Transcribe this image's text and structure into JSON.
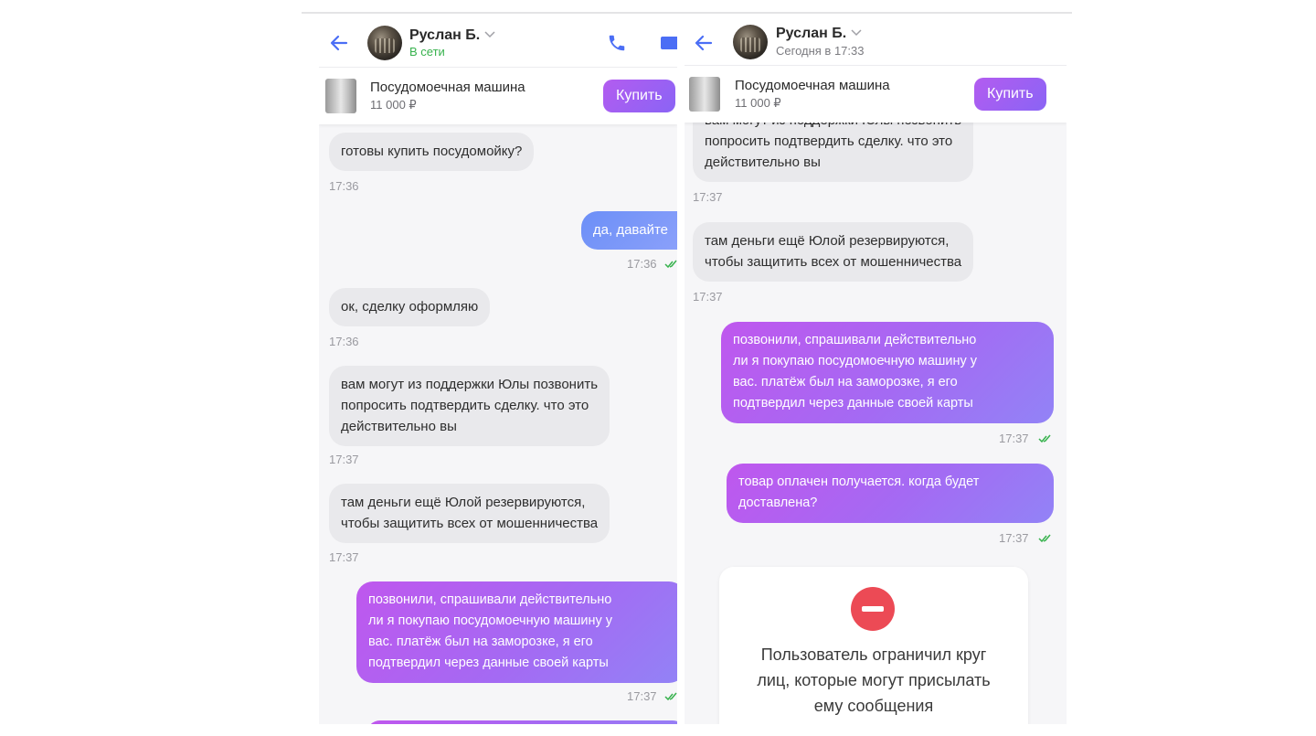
{
  "left": {
    "header": {
      "name": "Руслан Б.",
      "status": "В сети"
    },
    "product": {
      "name": "Посудомоечная машина",
      "price": "11 000 ₽",
      "buy_label": "Купить"
    },
    "messages": [
      {
        "dir": "in",
        "text": "готовы купить посудомойку?",
        "time": "17:36"
      },
      {
        "dir": "out",
        "text": "да, давайте",
        "time": "17:36"
      },
      {
        "dir": "in",
        "text": "ок, сделку оформляю",
        "time": "17:36"
      },
      {
        "dir": "in",
        "text": "вам могут из поддержки Юлы позвонить\nпопросить подтвердить сделку. что это\nдействительно вы",
        "time": "17:37"
      },
      {
        "dir": "in",
        "text": "там деньги ещё Юлой резервируются,\nчтобы защитить всех от мошенничества",
        "time": "17:37"
      },
      {
        "dir": "out",
        "text": "позвонили, спрашивали действительно\nли я покупаю посудомоечную машину у\nвас. платёж был на заморозке, я его\nподтвердил через данные своей карты",
        "time": "17:37"
      }
    ]
  },
  "right": {
    "header": {
      "name": "Руслан Б.",
      "status": "Сегодня в 17:33"
    },
    "product": {
      "name": "Посудомоечная машина",
      "price": "11 000 ₽",
      "buy_label": "Купить"
    },
    "messages": [
      {
        "dir": "in",
        "text": "вам могут из поддержки Юлы позвонить\nпопросить подтвердить сделку. что это\nдействительно вы",
        "time": "17:37"
      },
      {
        "dir": "in",
        "text": "там деньги ещё Юлой резервируются,\nчтобы защитить всех от мошенничества",
        "time": "17:37"
      },
      {
        "dir": "out",
        "text": "позвонили, спрашивали действительно\nли я покупаю посудомоечную машину у\nвас. платёж был на заморозке, я его\nподтвердил через данные своей карты",
        "time": "17:37"
      },
      {
        "dir": "out",
        "text": "товар оплачен получается. когда будет\nдоставлена?",
        "time": "17:37"
      }
    ],
    "blocked_notice": "Пользователь ограничил круг\nлиц, которые могут присылать\nему сообщения"
  },
  "colors": {
    "accent_purple": "#b35cf0",
    "accent_blue": "#6c8ff7",
    "online_green": "#37b24d",
    "check_green": "#37b24d",
    "block_red": "#ec4a55",
    "incoming_bubble": "#e9e9ec",
    "icon_blue": "#4b6ef5"
  },
  "icons": [
    "back-arrow-icon",
    "chevron-down-icon",
    "phone-icon",
    "video-icon",
    "read-check-icon",
    "stop-icon"
  ]
}
